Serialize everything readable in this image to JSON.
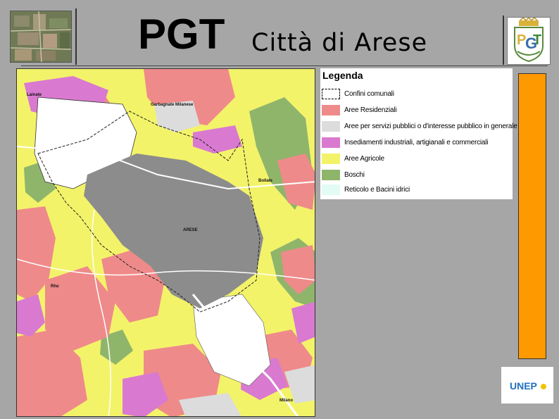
{
  "header": {
    "title_main": "PGT",
    "title_city": "Città di Arese",
    "logo_left_icon": "aerial-photo-icon",
    "logo_right_icon": "pgt-crest-icon"
  },
  "legend": {
    "title": "Legenda",
    "items": [
      {
        "label": "Confini comunali",
        "color": "#ffffff",
        "style": "dashed-border"
      },
      {
        "label": "Aree Residenziali",
        "color": "#ef8a8a",
        "style": "fill"
      },
      {
        "label": "Aree per servizi pubblici o d'interesse pubblico in generale",
        "color": "#dcdcdc",
        "style": "fill"
      },
      {
        "label": "Insediamenti industriali, artigianali e commerciali",
        "color": "#d97ad0",
        "style": "fill"
      },
      {
        "label": "Aree Agricole",
        "color": "#f3f36a",
        "style": "fill"
      },
      {
        "label": "Boschi",
        "color": "#8fb56b",
        "style": "fill"
      },
      {
        "label": "Reticolo e Bacini idrici",
        "color": "#e2fbf4",
        "style": "fill"
      }
    ]
  },
  "map": {
    "labels": {
      "lainate": "Lainate",
      "garbagnate": "Garbagnate Milanese",
      "bollate": "Bollate",
      "arese": "ARESE",
      "rho": "Rho",
      "milano": "Milano"
    },
    "colors": {
      "residential": "#ef8a8a",
      "industrial": "#d97ad0",
      "agricultural": "#f3f36a",
      "services": "#dcdcdc",
      "woods": "#8fb56b",
      "urban_gray": "#8c8c8c",
      "roads": "#ffffff"
    }
  },
  "side_panel": {
    "bar_color": "#ff9900",
    "bottom_logo_icon": "unep-logo-icon",
    "bottom_logo_text": "UNEP"
  }
}
